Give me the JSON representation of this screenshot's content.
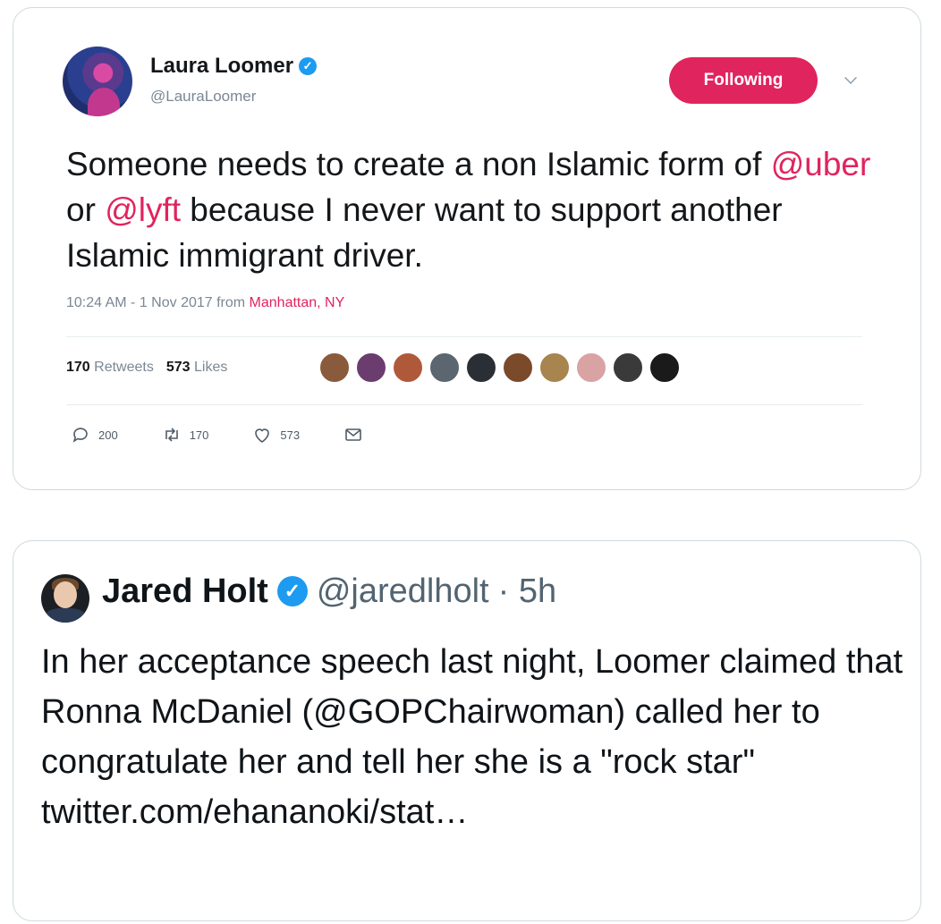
{
  "embedded_tweet": {
    "author_name": "Laura Loomer",
    "handle": "@LauraLoomer",
    "follow_button_label": "Following",
    "text_parts": {
      "p1": "Someone needs to create a non Islamic form of ",
      "m1": "@uber",
      "p2": " or ",
      "m2": "@lyft",
      "p3": " because I never want to support another Islamic immigrant driver."
    },
    "timestamp": "10:24 AM - 1 Nov 2017 from ",
    "location": "Manhattan, NY",
    "retweets_count": "170",
    "retweets_label": "Retweets",
    "likes_count": "573",
    "likes_label": "Likes",
    "actions": {
      "replies": "200",
      "retweets": "170",
      "likes": "573"
    },
    "colors": {
      "accent": "#e0245e",
      "verified": "#1d9bf0"
    }
  },
  "quote_tweet": {
    "author_name": "Jared Holt",
    "handle": "@jaredlholt",
    "time": "· 5h",
    "text": "In her acceptance speech last night, Loomer claimed that Ronna McDaniel (@GOPChairwoman) called her to congratulate her and tell her she is a \"rock star\" twitter.com/ehananoki/stat…"
  }
}
